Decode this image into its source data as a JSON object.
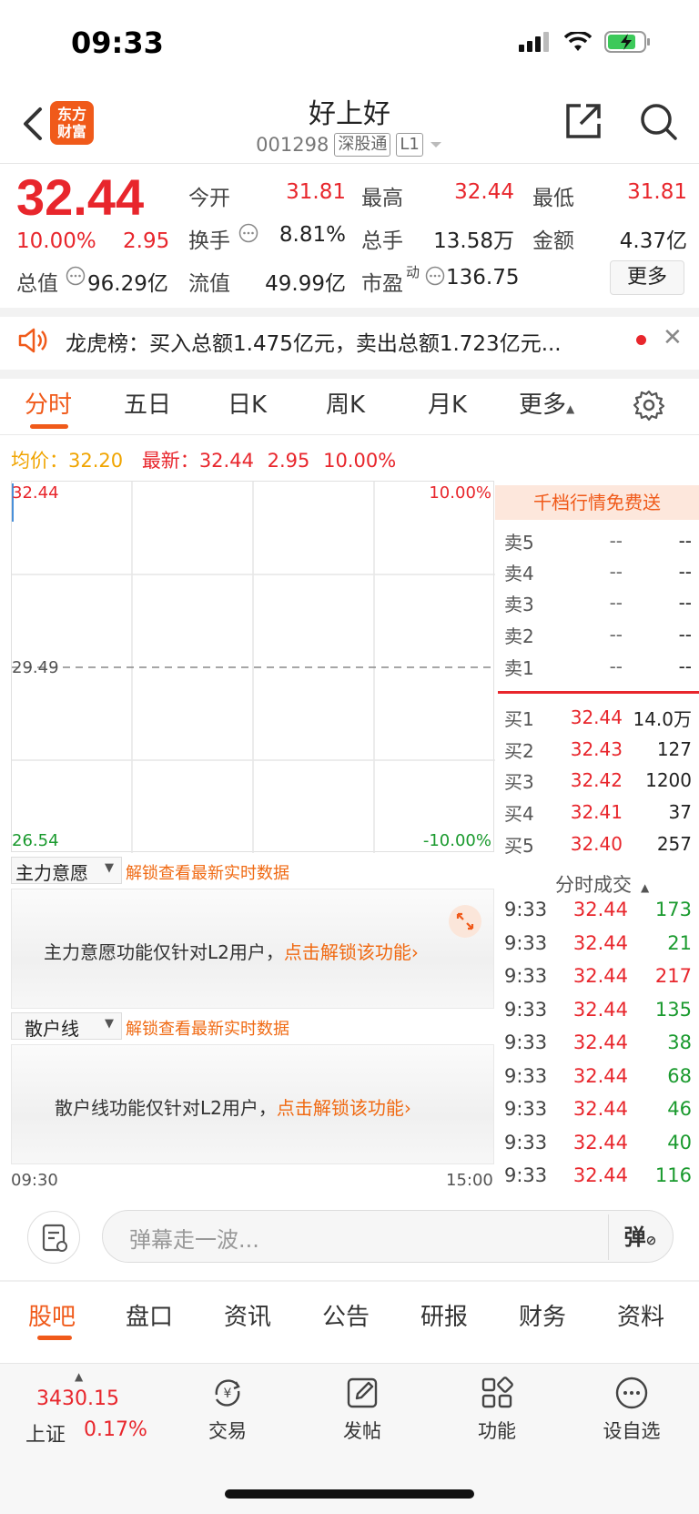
{
  "status": {
    "time": "09:33"
  },
  "header": {
    "logo_line1": "东方",
    "logo_line2": "财富",
    "title": "好上好",
    "code": "001298",
    "tag1": "深股通",
    "tag2": "L1"
  },
  "quote": {
    "price": "32.44",
    "pct": "10.00%",
    "chg": "2.95",
    "open_label": "今开",
    "open": "31.81",
    "high_label": "最高",
    "high": "32.44",
    "low_label": "最低",
    "low": "31.81",
    "turnover_label": "换手",
    "turnover": "8.81%",
    "volume_label": "总手",
    "volume": "13.58万",
    "amount_label": "金额",
    "amount": "4.37亿",
    "mcap_label": "总值",
    "mcap": "96.29亿",
    "float_label": "流值",
    "float": "49.99亿",
    "pe_label": "市盈",
    "pe_sup": "动",
    "pe": "136.75",
    "more_label": "更多"
  },
  "notice": {
    "text": "龙虎榜：买入总额1.475亿元，卖出总额1.723亿元..."
  },
  "tabs": [
    "分时",
    "五日",
    "日K",
    "周K",
    "月K",
    "更多"
  ],
  "avg": {
    "avg_label": "均价：",
    "avg": "32.20",
    "latest_label": "最新：",
    "latest": "32.44",
    "chg": "2.95",
    "pct": "10.00%"
  },
  "chart": {
    "y_top": "32.44",
    "y_mid": "29.49",
    "y_bot": "26.54",
    "pct_top": "10.00%",
    "pct_bot": "-10.00%",
    "time_start": "09:30",
    "time_end": "15:00"
  },
  "panels": {
    "p1_select": "主力意愿",
    "p1_unlock": "解锁查看最新实时数据",
    "p1_msg": "主力意愿功能仅针对L2用户，",
    "p1_link": "点击解锁该功能",
    "p2_select": "散户线",
    "p2_unlock": "解锁查看最新实时数据",
    "p2_msg": "散户线功能仅针对L2用户，",
    "p2_link": "点击解锁该功能"
  },
  "orderbook": {
    "banner": "千档行情免费送",
    "sells": [
      {
        "label": "卖5",
        "price": "--",
        "vol": "--"
      },
      {
        "label": "卖4",
        "price": "--",
        "vol": "--"
      },
      {
        "label": "卖3",
        "price": "--",
        "vol": "--"
      },
      {
        "label": "卖2",
        "price": "--",
        "vol": "--"
      },
      {
        "label": "卖1",
        "price": "--",
        "vol": "--"
      }
    ],
    "buys": [
      {
        "label": "买1",
        "price": "32.44",
        "vol": "14.0万"
      },
      {
        "label": "买2",
        "price": "32.43",
        "vol": "127"
      },
      {
        "label": "买3",
        "price": "32.42",
        "vol": "1200"
      },
      {
        "label": "买4",
        "price": "32.41",
        "vol": "37"
      },
      {
        "label": "买5",
        "price": "32.40",
        "vol": "257"
      }
    ],
    "ticks_title": "分时成交",
    "ticks": [
      {
        "time": "9:33",
        "price": "32.44",
        "vol": "173",
        "color": "green"
      },
      {
        "time": "9:33",
        "price": "32.44",
        "vol": "21",
        "color": "green"
      },
      {
        "time": "9:33",
        "price": "32.44",
        "vol": "217",
        "color": "red"
      },
      {
        "time": "9:33",
        "price": "32.44",
        "vol": "135",
        "color": "green"
      },
      {
        "time": "9:33",
        "price": "32.44",
        "vol": "38",
        "color": "green"
      },
      {
        "time": "9:33",
        "price": "32.44",
        "vol": "68",
        "color": "green"
      },
      {
        "time": "9:33",
        "price": "32.44",
        "vol": "46",
        "color": "green"
      },
      {
        "time": "9:33",
        "price": "32.44",
        "vol": "40",
        "color": "green"
      },
      {
        "time": "9:33",
        "price": "32.44",
        "vol": "116",
        "color": "green"
      }
    ]
  },
  "comment": {
    "placeholder": "弹幕走一波...",
    "button": "弹"
  },
  "bottom_tabs": [
    "股吧",
    "盘口",
    "资讯",
    "公告",
    "研报",
    "财务",
    "资料"
  ],
  "nav": {
    "index_value": "3430.15",
    "index_name": "上证",
    "index_pct": "0.17%",
    "items": [
      "交易",
      "发帖",
      "功能",
      "设自选"
    ]
  }
}
